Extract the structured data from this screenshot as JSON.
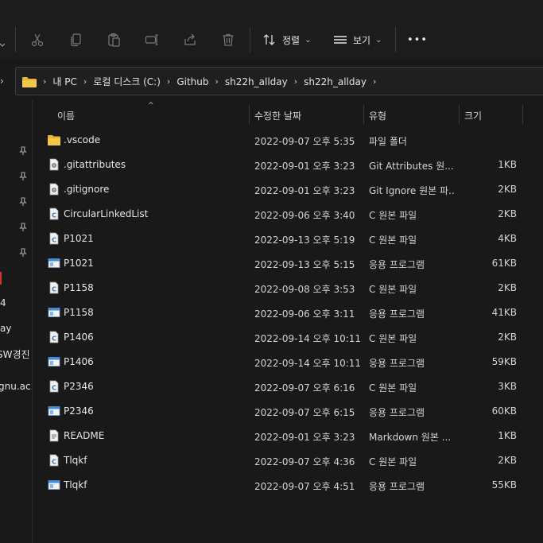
{
  "toolbar": {
    "sort_label": "정렬",
    "view_label": "보기",
    "more_label": "•••"
  },
  "address": {
    "items": [
      "내 PC",
      "로컬 디스크 (C:)",
      "Github",
      "sh22h_allday",
      "sh22h_allday"
    ]
  },
  "nav": {
    "partial_items": [
      "4",
      "ay",
      "SW경진",
      "gnu.ac.k"
    ]
  },
  "columns": {
    "name": "이름",
    "date": "수정한 날짜",
    "type": "유형",
    "size": "크기"
  },
  "files": [
    {
      "name": ".vscode",
      "date": "2022-09-07 오후 5:35",
      "type": "파일 폴더",
      "size": "",
      "icon": "folder-icon"
    },
    {
      "name": ".gitattributes",
      "date": "2022-09-01 오후 3:23",
      "type": "Git Attributes 원...",
      "size": "1KB",
      "icon": "config-file-icon"
    },
    {
      "name": ".gitignore",
      "date": "2022-09-01 오후 3:23",
      "type": "Git Ignore 원본 파...",
      "size": "2KB",
      "icon": "config-file-icon"
    },
    {
      "name": "CircularLinkedList",
      "date": "2022-09-06 오후 3:40",
      "type": "C 원본 파일",
      "size": "2KB",
      "icon": "c-source-file-icon"
    },
    {
      "name": "P1021",
      "date": "2022-09-13 오후 5:19",
      "type": "C 원본 파일",
      "size": "4KB",
      "icon": "c-source-file-icon"
    },
    {
      "name": "P1021",
      "date": "2022-09-13 오후 5:15",
      "type": "응용 프로그램",
      "size": "61KB",
      "icon": "application-icon"
    },
    {
      "name": "P1158",
      "date": "2022-09-08 오후 3:53",
      "type": "C 원본 파일",
      "size": "2KB",
      "icon": "c-source-file-icon"
    },
    {
      "name": "P1158",
      "date": "2022-09-06 오후 3:11",
      "type": "응용 프로그램",
      "size": "41KB",
      "icon": "application-icon"
    },
    {
      "name": "P1406",
      "date": "2022-09-14 오후 10:11",
      "type": "C 원본 파일",
      "size": "2KB",
      "icon": "c-source-file-icon"
    },
    {
      "name": "P1406",
      "date": "2022-09-14 오후 10:11",
      "type": "응용 프로그램",
      "size": "59KB",
      "icon": "application-icon"
    },
    {
      "name": "P2346",
      "date": "2022-09-07 오후 6:16",
      "type": "C 원본 파일",
      "size": "3KB",
      "icon": "c-source-file-icon"
    },
    {
      "name": "P2346",
      "date": "2022-09-07 오후 6:15",
      "type": "응용 프로그램",
      "size": "60KB",
      "icon": "application-icon"
    },
    {
      "name": "README",
      "date": "2022-09-01 오후 3:23",
      "type": "Markdown 원본 ...",
      "size": "1KB",
      "icon": "markdown-file-icon"
    },
    {
      "name": "Tlqkf",
      "date": "2022-09-07 오후 4:36",
      "type": "C 원본 파일",
      "size": "2KB",
      "icon": "c-source-file-icon"
    },
    {
      "name": "Tlqkf",
      "date": "2022-09-07 오후 4:51",
      "type": "응용 프로그램",
      "size": "55KB",
      "icon": "application-icon"
    }
  ],
  "colors": {
    "background": "#191919",
    "folder": "#e8b33a",
    "app_blue": "#3a8ee6",
    "pin": "#a6a6a6"
  }
}
